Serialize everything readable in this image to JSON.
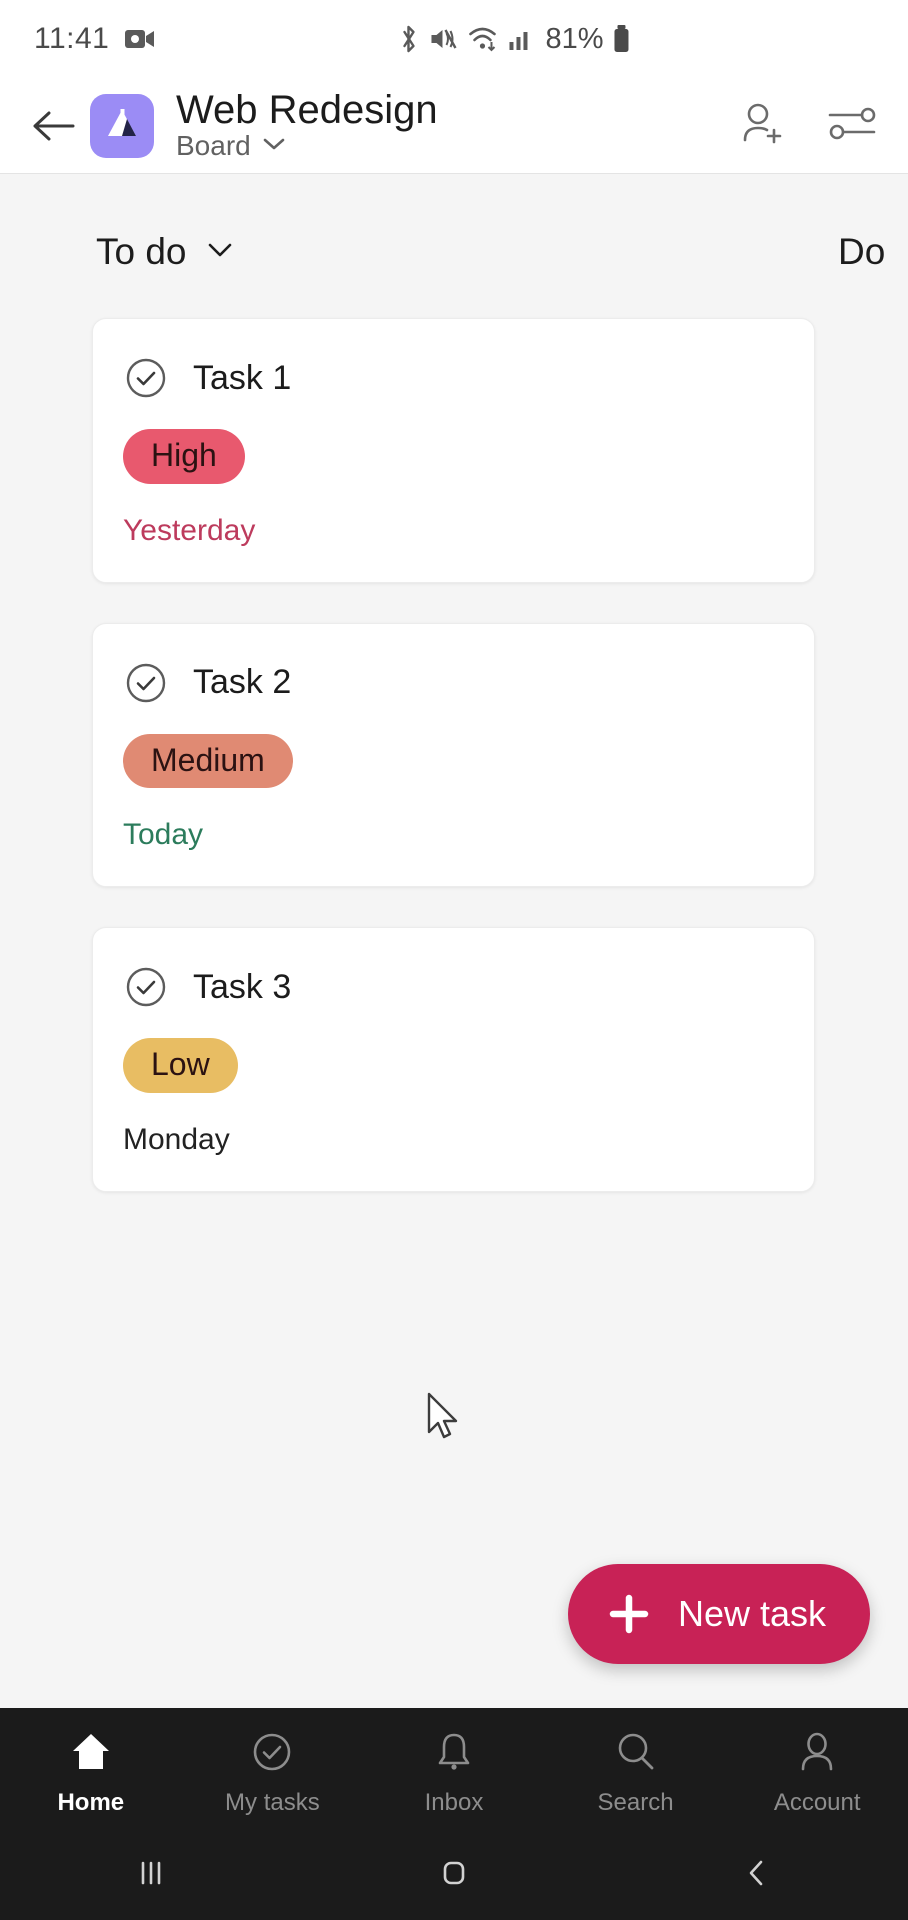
{
  "status_bar": {
    "time": "11:41",
    "battery_percent": "81%",
    "icons": [
      "screen-record-icon",
      "bluetooth-icon",
      "mute-icon",
      "wifi-icon",
      "cellular-signal-icon",
      "battery-icon"
    ]
  },
  "header": {
    "back_label": "back-arrow",
    "logo_name": "mountain-logo",
    "title": "Web Redesign",
    "subtitle": "Board",
    "subtitle_chevron": "chevron-down-icon",
    "actions": [
      {
        "name": "add-member-button",
        "icon": "person-add-icon"
      },
      {
        "name": "filter-button",
        "icon": "sliders-icon"
      }
    ]
  },
  "board": {
    "columns": [
      {
        "title": "To do",
        "chevron": "chevron-down-icon"
      },
      {
        "title": "Do"
      }
    ],
    "cards": [
      {
        "title": "Task 1",
        "priority": "High",
        "priority_class": "pill-high",
        "due": "Yesterday",
        "due_class": "due-overdue",
        "check": "check-circle-icon"
      },
      {
        "title": "Task 2",
        "priority": "Medium",
        "priority_class": "pill-medium",
        "due": "Today",
        "due_class": "due-today",
        "check": "check-circle-icon"
      },
      {
        "title": "Task 3",
        "priority": "Low",
        "priority_class": "pill-low",
        "due": "Monday",
        "due_class": "due-normal",
        "check": "check-circle-icon"
      }
    ]
  },
  "fab": {
    "label": "New task",
    "icon": "plus-icon",
    "color": "#c82256"
  },
  "bottom_nav": {
    "items": [
      {
        "label": "Home",
        "icon": "home-icon",
        "active": true
      },
      {
        "label": "My tasks",
        "icon": "check-circle-icon",
        "active": false
      },
      {
        "label": "Inbox",
        "icon": "bell-icon",
        "active": false
      },
      {
        "label": "Search",
        "icon": "search-icon",
        "active": false
      },
      {
        "label": "Account",
        "icon": "person-icon",
        "active": false
      }
    ]
  },
  "system_nav": {
    "items": [
      {
        "name": "recents-button",
        "icon": "recents-icon"
      },
      {
        "name": "home-button",
        "icon": "home-square-icon"
      },
      {
        "name": "back-button",
        "icon": "back-chevron-icon"
      }
    ]
  },
  "colors": {
    "accent": "#c82256",
    "logo_bg": "#9b8cf5",
    "priority_high": "#e8596e",
    "priority_medium": "#e08a73",
    "priority_low": "#e8bd63",
    "overdue_text": "#bd3b5d",
    "today_text": "#2c7c5c"
  }
}
